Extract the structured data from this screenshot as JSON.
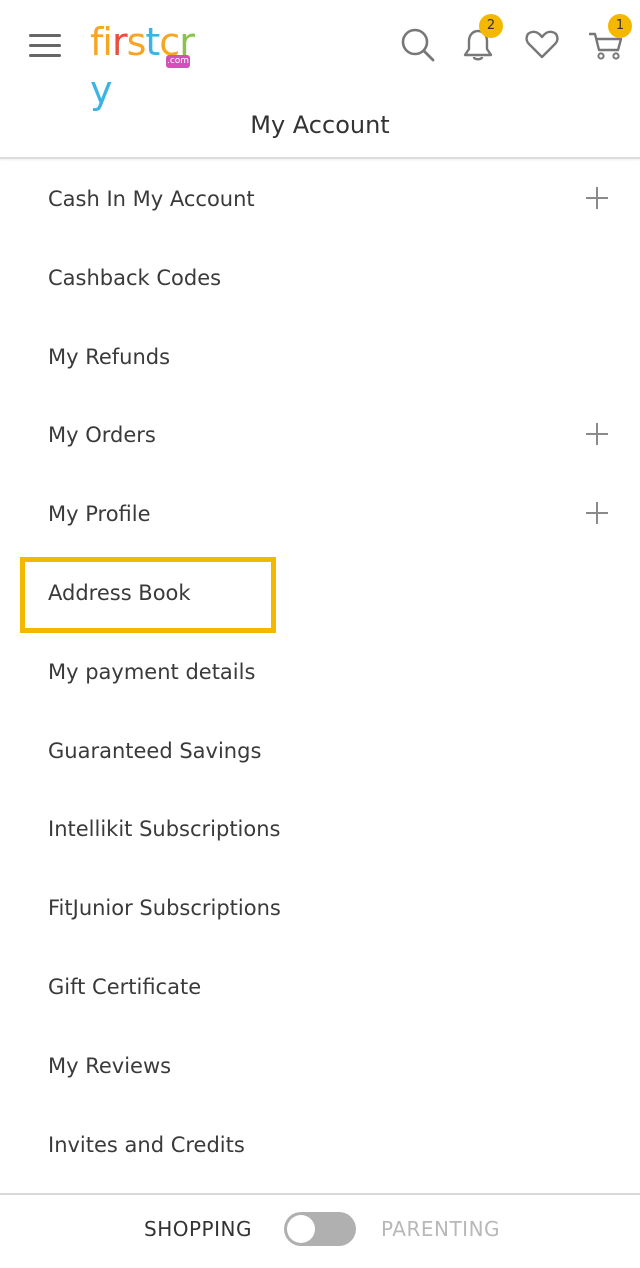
{
  "header": {
    "logo_text": "firstcry",
    "logo_subtext": ".com",
    "notifications_count": "2",
    "cart_count": "1",
    "title": "My Account"
  },
  "menu": {
    "items": [
      {
        "label": "Cash In My Account",
        "expandable": true
      },
      {
        "label": "Cashback Codes",
        "expandable": false
      },
      {
        "label": "My Refunds",
        "expandable": false
      },
      {
        "label": "My Orders",
        "expandable": true
      },
      {
        "label": "My Profile",
        "expandable": true
      },
      {
        "label": "Address Book",
        "expandable": false,
        "highlighted": true
      },
      {
        "label": "My payment details",
        "expandable": false
      },
      {
        "label": "Guaranteed Savings",
        "expandable": false
      },
      {
        "label": "Intellikit Subscriptions",
        "expandable": false
      },
      {
        "label": "FitJunior Subscriptions",
        "expandable": false
      },
      {
        "label": "Gift Certificate",
        "expandable": false
      },
      {
        "label": "My Reviews",
        "expandable": false
      },
      {
        "label": "Invites and Credits",
        "expandable": false
      }
    ]
  },
  "footer": {
    "left_label": "SHOPPING",
    "right_label": "PARENTING",
    "toggle_state": "off"
  },
  "icons": {
    "menu": "hamburger-icon",
    "search": "search-icon",
    "notifications": "bell-icon",
    "wishlist": "heart-icon",
    "cart": "cart-icon",
    "expand": "plus-icon"
  },
  "colors": {
    "accent": "#f5b800",
    "highlight_border": "#f5b800",
    "logo_f": "#f5a623",
    "logo_i": "#f5a623",
    "logo_r": "#e84f3d",
    "logo_s": "#f5a623",
    "logo_t": "#3bb4e5",
    "logo_c": "#f5a623",
    "logo_r2": "#8bc34a",
    "logo_y": "#3bb4e5",
    "logo_com_bg": "#d44fb8"
  }
}
